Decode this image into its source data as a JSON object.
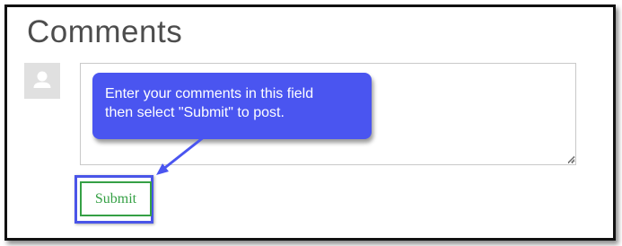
{
  "section": {
    "title": "Comments"
  },
  "comment_box": {
    "value": "",
    "placeholder": ""
  },
  "submit": {
    "label": "Submit"
  },
  "callout": {
    "line1": "Enter your comments in this field",
    "line2": "then select \"Submit\" to post."
  },
  "icons": {
    "avatar": "user-silhouette-icon",
    "resize": "resize-grip-icon"
  },
  "colors": {
    "callout_bg": "#4a55f0",
    "highlight_border": "#4a55e8",
    "submit_green": "#35a045",
    "title_gray": "#4d4d4d",
    "avatar_bg": "#e0e0e0"
  }
}
